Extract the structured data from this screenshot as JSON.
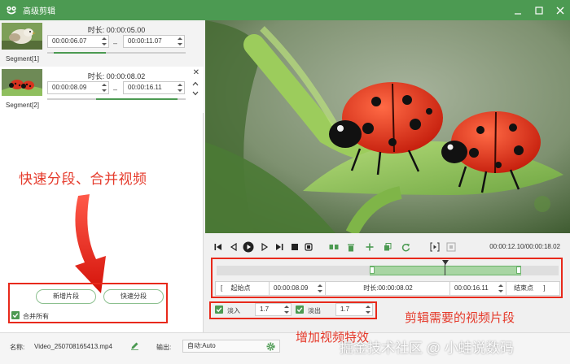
{
  "window": {
    "title": "高级剪辑",
    "controls": [
      "minimize-icon",
      "maximize-icon",
      "close-icon"
    ]
  },
  "segments": [
    {
      "label": "Segment[1]",
      "duration_label": "时长:",
      "duration": "00:00:05.00",
      "start": "00:00:06.07",
      "end": "00:00:11.07",
      "separator": "–",
      "progress": 0.35
    },
    {
      "label": "Segment[2]",
      "duration_label": "时长:",
      "duration": "00:00:08.02",
      "start": "00:00:08.09",
      "end": "00:00:16.11",
      "separator": "–",
      "progress": 0.7
    }
  ],
  "left_actions": {
    "new_segment": "新增片段",
    "quick_split": "快速分段",
    "merge_all": "合并所有",
    "merge_all_checked": true
  },
  "annotations": {
    "left": "快速分段、合并视频",
    "right_clip": "剪辑需要的视频片段",
    "effects": "增加视频特效",
    "watermark": "掘金技术社区 @ 小蛙说数码"
  },
  "player": {
    "time_current": "00:00:12.10",
    "time_total": "00:00:18.02",
    "time_separator": "/",
    "icons": [
      "go-start-icon",
      "step-back-icon",
      "play-icon",
      "step-forward-icon",
      "go-end-icon",
      "stop-icon",
      "record-icon",
      "split-icon",
      "delete-icon",
      "add-icon",
      "copy-icon",
      "reset-icon",
      "mark-in-icon",
      "mark-out-icon"
    ]
  },
  "segment_editor": {
    "start_bracket": "[",
    "start_label": "起始点",
    "start_value": "00:00:08.09",
    "duration_label": "时长:",
    "duration_value": "00:00:08.02",
    "end_value": "00:00:16.11",
    "end_label": "结束点",
    "end_bracket": "]"
  },
  "effects": {
    "fade_in_label": "淡入",
    "fade_in_value": "1.7",
    "fade_in_checked": true,
    "fade_out_label": "淡出",
    "fade_out_value": "1.7",
    "fade_out_checked": true
  },
  "footer": {
    "name_label": "名称:",
    "name_value": "Video_250708165413.mp4",
    "output_label": "输出:",
    "output_value": "自动:Auto"
  },
  "colors": {
    "accent": "#4c9a52",
    "annotation_red": "#e53a2b"
  }
}
